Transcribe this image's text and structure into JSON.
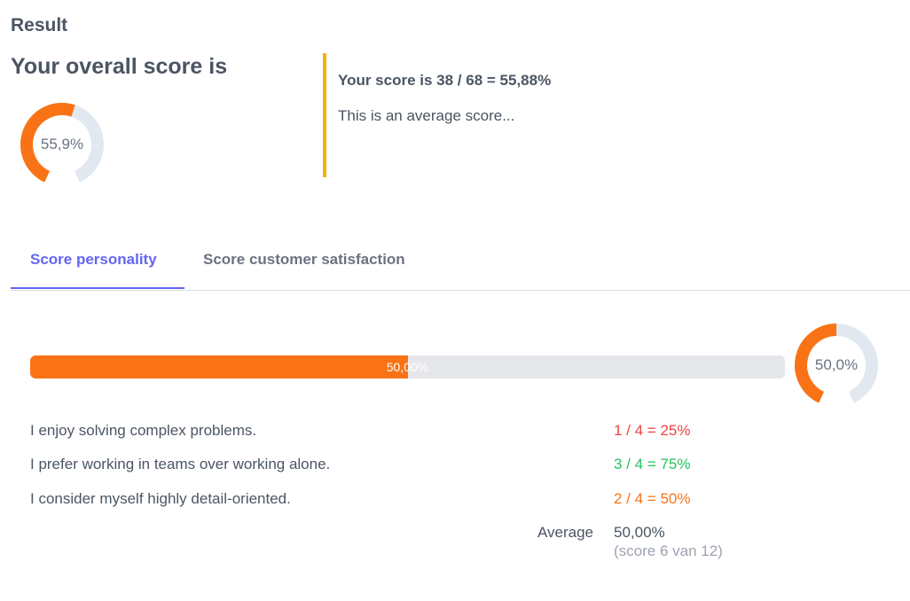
{
  "result": {
    "heading": "Result",
    "overall_title": "Your overall score is",
    "gauge": {
      "label": "55,9%",
      "fraction": 0.559,
      "color": "#f97316",
      "track": "#e2e8f0"
    },
    "callout": {
      "score_text": "Your score is 38 / 68 = 55,88%",
      "description": "This is an average score...",
      "border_color": "#f2b400"
    }
  },
  "tabs": [
    {
      "label": "Score personality",
      "active": true
    },
    {
      "label": "Score customer satisfaction",
      "active": false
    }
  ],
  "personality": {
    "progress": {
      "label": "50,00%",
      "fraction": 0.5,
      "color": "#f97316",
      "track": "#e5e7eb"
    },
    "gauge": {
      "label": "50,0%",
      "fraction": 0.5,
      "color": "#f97316",
      "track": "#e2e8f0"
    },
    "statements": [
      {
        "text": "I enjoy solving complex problems.",
        "score": "1 / 4 = 25%",
        "color": "#ef4444"
      },
      {
        "text": "I prefer working in teams over working alone.",
        "score": "3 / 4 = 75%",
        "color": "#22c55e"
      },
      {
        "text": "I consider myself highly detail-oriented.",
        "score": "2 / 4 = 50%",
        "color": "#f97316"
      }
    ],
    "average": {
      "label": "Average",
      "value": "50,00%",
      "detail": "(score 6 van 12)"
    }
  }
}
